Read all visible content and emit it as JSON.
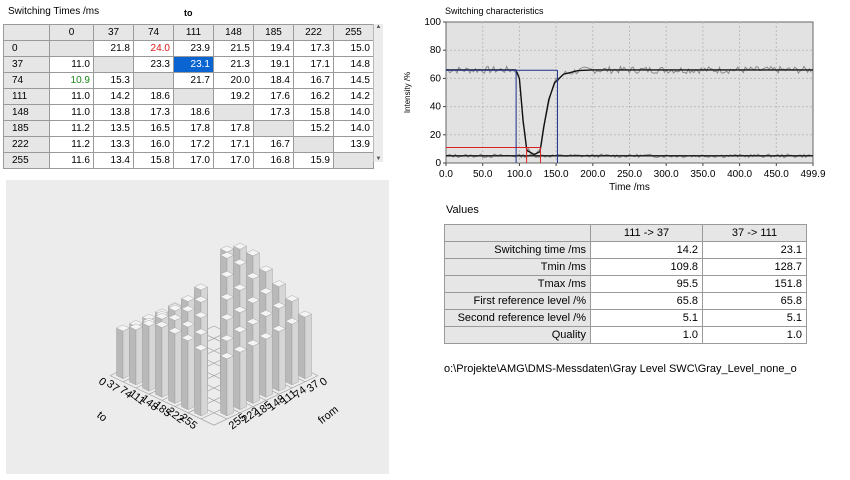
{
  "switching_times": {
    "title": "Switching Times /ms",
    "to_label": "to",
    "columns": [
      "0",
      "37",
      "74",
      "111",
      "148",
      "185",
      "222",
      "255"
    ],
    "rows": [
      {
        "label": "0",
        "cells": [
          "",
          "21.8",
          "24.0",
          "23.9",
          "21.5",
          "19.4",
          "17.3",
          "15.0"
        ]
      },
      {
        "label": "37",
        "cells": [
          "11.0",
          "",
          "23.3",
          "23.1",
          "21.3",
          "19.1",
          "17.1",
          "14.8"
        ]
      },
      {
        "label": "74",
        "cells": [
          "10.9",
          "15.3",
          "",
          "21.7",
          "20.0",
          "18.4",
          "16.7",
          "14.5"
        ]
      },
      {
        "label": "111",
        "cells": [
          "11.0",
          "14.2",
          "18.6",
          "",
          "19.2",
          "17.6",
          "16.2",
          "14.2"
        ]
      },
      {
        "label": "148",
        "cells": [
          "11.0",
          "13.8",
          "17.3",
          "18.6",
          "",
          "17.3",
          "15.8",
          "14.0"
        ]
      },
      {
        "label": "185",
        "cells": [
          "11.2",
          "13.5",
          "16.5",
          "17.8",
          "17.8",
          "",
          "15.2",
          "14.0"
        ]
      },
      {
        "label": "222",
        "cells": [
          "11.2",
          "13.3",
          "16.0",
          "17.2",
          "17.1",
          "16.7",
          "",
          "13.9"
        ]
      },
      {
        "label": "255",
        "cells": [
          "11.6",
          "13.4",
          "15.8",
          "17.0",
          "17.0",
          "16.8",
          "15.9",
          ""
        ]
      }
    ],
    "selected": {
      "row": 1,
      "col": 3
    },
    "highlight_max": {
      "row": 0,
      "col": 2,
      "color": "#d81818"
    },
    "highlight_min": {
      "row": 2,
      "col": 0,
      "color": "#1a8a1a"
    },
    "selected_color": "#0a64d2"
  },
  "chart_data": {
    "type": "line",
    "title": "Switching characteristics",
    "xlabel": "Time /ms",
    "ylabel": "Intensity /%",
    "xlim": [
      0,
      499.9
    ],
    "ylim": [
      0,
      100
    ],
    "xticks": [
      "0.0",
      "50.0",
      "100.0",
      "150.0",
      "200.0",
      "250.0",
      "300.0",
      "350.0",
      "400.0",
      "450.0",
      "499.9"
    ],
    "yticks": [
      "0",
      "20",
      "40",
      "60",
      "80",
      "100"
    ],
    "grid": true,
    "series": [
      {
        "values": [
          [
            0,
            66
          ],
          [
            95,
            66
          ],
          [
            100,
            60
          ],
          [
            105,
            30
          ],
          [
            110,
            9
          ],
          [
            120,
            6
          ],
          [
            128,
            8
          ],
          [
            133,
            25
          ],
          [
            140,
            45
          ],
          [
            148,
            57
          ],
          [
            160,
            63
          ],
          [
            180,
            65.5
          ],
          [
            200,
            66
          ],
          [
            499.9,
            66
          ]
        ]
      },
      {
        "values": [
          [
            0,
            5.1
          ],
          [
            499.9,
            5.1
          ]
        ]
      }
    ],
    "reference_lines": {
      "first_level": 65.8,
      "second_level": 5.1,
      "markers_x": [
        95.5,
        109.8,
        128.7,
        151.8
      ]
    },
    "colors": {
      "curve": "#111111",
      "noise": "#8c8c8c",
      "marker": "#1c2f8a",
      "red_marker": "#e02020",
      "plot_bg": "#e2e2e2"
    }
  },
  "values_table": {
    "title": "Values",
    "columns": [
      "111 -> 37",
      "37 -> 111"
    ],
    "rows": [
      {
        "label": "Switching time /ms",
        "v1": "14.2",
        "v2": "23.1"
      },
      {
        "label": "Tmin /ms",
        "v1": "109.8",
        "v2": "128.7"
      },
      {
        "label": "Tmax /ms",
        "v1": "95.5",
        "v2": "151.8"
      },
      {
        "label": "First reference level /%",
        "v1": "65.8",
        "v2": "65.8"
      },
      {
        "label": "Second reference level /%",
        "v1": "5.1",
        "v2": "5.1"
      },
      {
        "label": "Quality",
        "v1": "1.0",
        "v2": "1.0"
      }
    ]
  },
  "file_path": "o:\\Projekte\\AMG\\DMS-Messdaten\\Gray Level SWC\\Gray_Level_none_o",
  "plot3d": {
    "axis_to_label": "to",
    "axis_from_label": "from",
    "to_ticks": [
      "0",
      "37",
      "74",
      "111",
      "148",
      "185",
      "222",
      "255"
    ],
    "from_ticks": [
      "0",
      "37",
      "74",
      "111",
      "148",
      "185",
      "222",
      "255"
    ],
    "bar_color": "#cfcfcf"
  }
}
